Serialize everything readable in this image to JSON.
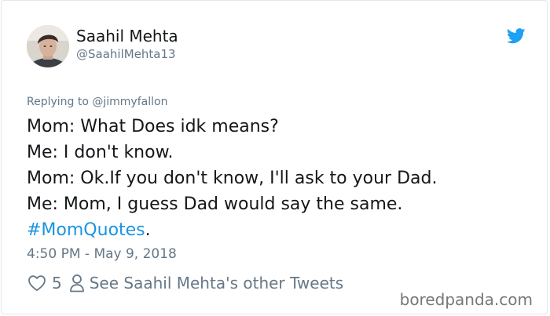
{
  "author": {
    "display_name": "Saahil Mehta",
    "handle": "@SaahilMehta13"
  },
  "replying_to": "Replying to @jimmyfallon",
  "tweet": {
    "lines": [
      "Mom: What Does idk means?",
      "Me: I don't know.",
      "Mom: Ok.If you don't know, I'll ask to your Dad.",
      "Me: Mom, I guess Dad would say the same."
    ],
    "hashtag": "#MomQuotes",
    "after_hashtag": "."
  },
  "timestamp": "4:50 PM - May 9, 2018",
  "actions": {
    "like_count": "5",
    "see_others": "See Saahil Mehta's other Tweets"
  },
  "watermark": "boredpanda.com",
  "colors": {
    "link": "#1b95e0",
    "muted": "#657786",
    "text": "#14171a"
  },
  "icons": {
    "brand": "twitter-bird-icon",
    "like": "heart-icon",
    "profile": "person-icon"
  }
}
